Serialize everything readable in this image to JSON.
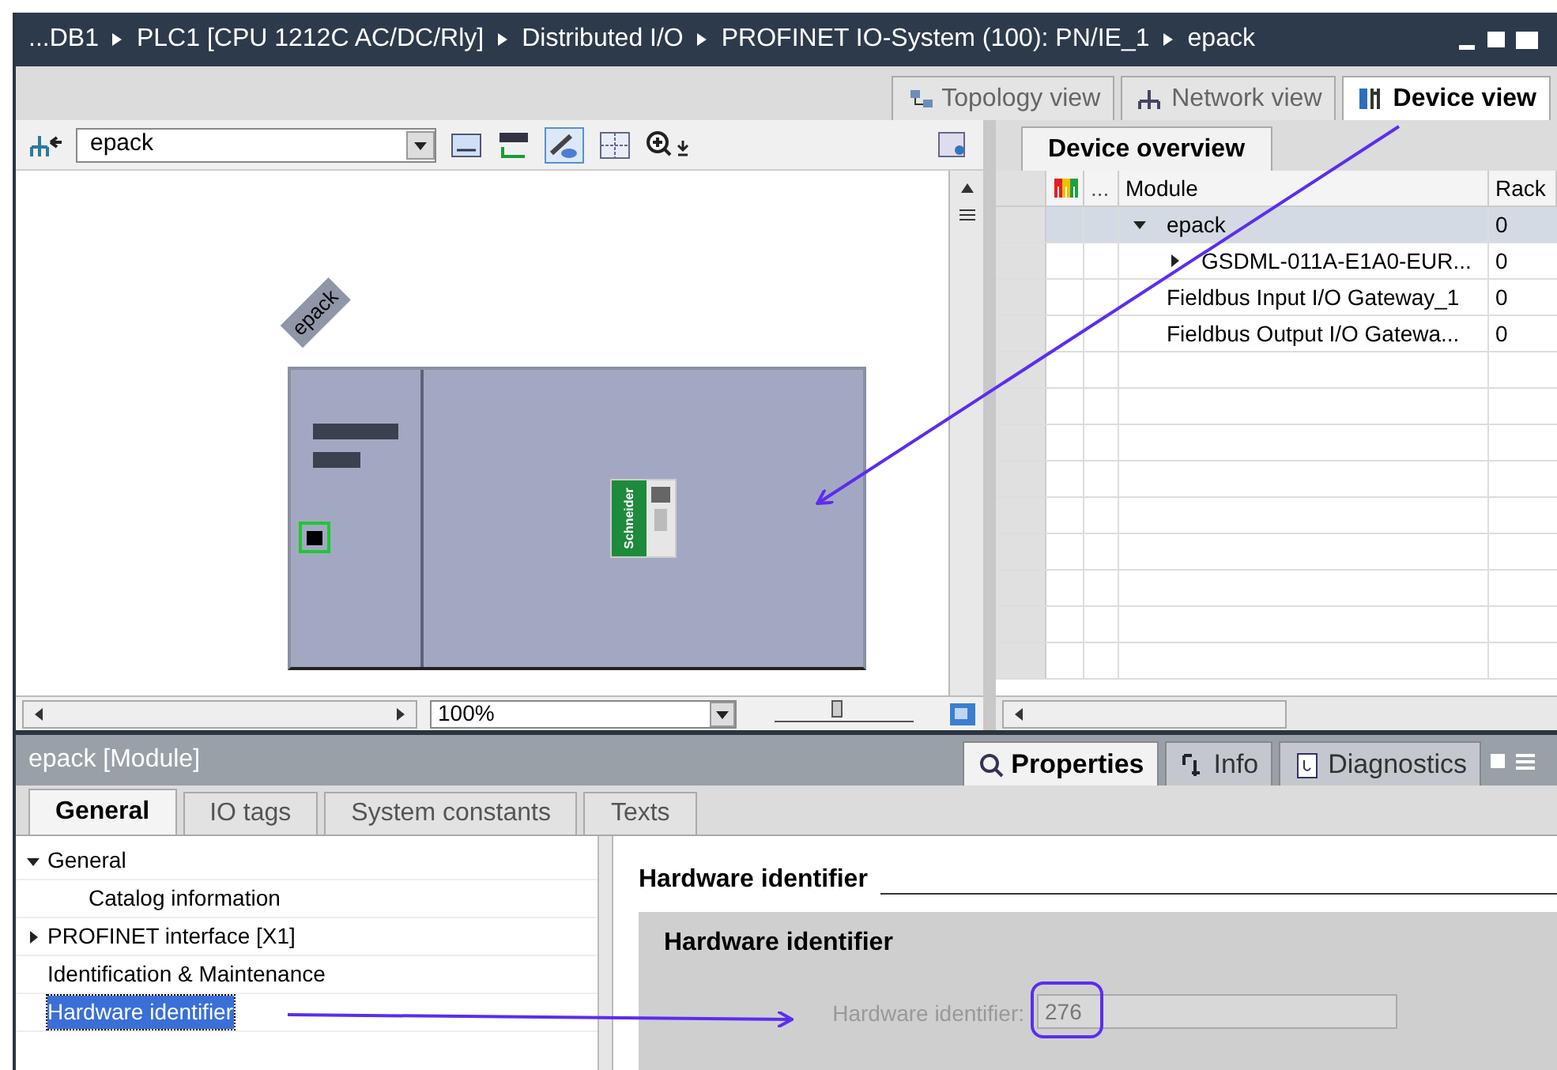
{
  "breadcrumb": [
    "...DB1",
    "PLC1 [CPU 1212C AC/DC/Rly]",
    "Distributed I/O",
    "PROFINET IO-System (100): PN/IE_1",
    "epack"
  ],
  "view_tabs": [
    {
      "label": "Topology view",
      "selected": false
    },
    {
      "label": "Network view",
      "selected": false
    },
    {
      "label": "Device view",
      "selected": true
    }
  ],
  "toolbar": {
    "device_select": "epack"
  },
  "canvas": {
    "device_label": "epack",
    "module_logo": "Schneider",
    "zoom": "100%",
    "zoom_slider": {
      "level": 0.45
    }
  },
  "device_overview": {
    "tab": "Device overview",
    "columns": [
      "...",
      "Module",
      "Rack"
    ],
    "rows": [
      {
        "module": "epack",
        "rack": "0",
        "expanded": true,
        "selected": true,
        "children": [
          {
            "module": "GSDML-011A-E1A0-EUR...",
            "rack": "0",
            "expanded": false,
            "selected": false
          }
        ]
      },
      {
        "module": "Fieldbus Input I/O Gateway_1",
        "rack": "0",
        "selected": false
      },
      {
        "module": "Fieldbus Output I/O Gatewa...",
        "rack": "0",
        "selected": false
      }
    ]
  },
  "properties": {
    "title": "epack [Module]",
    "tabs": [
      {
        "label": "Properties",
        "selected": true
      },
      {
        "label": "Info",
        "selected": false
      },
      {
        "label": "Diagnostics",
        "selected": false
      }
    ],
    "sub_tabs": [
      {
        "label": "General",
        "selected": true
      },
      {
        "label": "IO tags",
        "selected": false
      },
      {
        "label": "System constants",
        "selected": false
      },
      {
        "label": "Texts",
        "selected": false
      }
    ],
    "tree": [
      {
        "label": "General",
        "expanded": true,
        "selected": false,
        "children": [
          {
            "label": "Catalog information",
            "selected": false
          }
        ]
      },
      {
        "label": "PROFINET interface [X1]",
        "expanded": false,
        "selected": false
      },
      {
        "label": "Identification & Maintenance",
        "selected": false
      },
      {
        "label": "Hardware identifier",
        "selected": true
      }
    ],
    "section_title": "Hardware identifier",
    "group_title": "Hardware identifier",
    "field": {
      "label": "Hardware identifier:",
      "value": "276",
      "disabled": true
    }
  }
}
